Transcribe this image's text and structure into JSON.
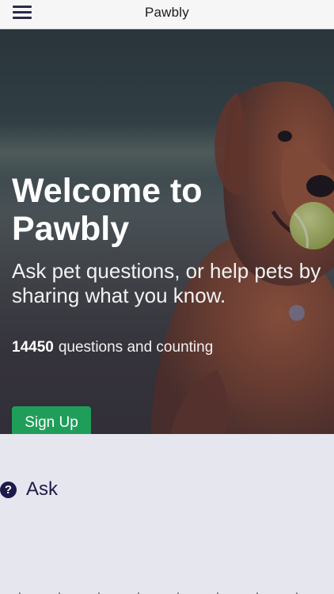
{
  "navbar": {
    "title": "Pawbly",
    "menu_icon": "hamburger-menu-icon"
  },
  "hero": {
    "title": "Welcome to Pawbly",
    "subtitle": "Ask pet questions, or help pets by sharing what you know.",
    "question_count": "14450",
    "question_count_suffix": "questions and counting",
    "signup_label": "Sign Up"
  },
  "ask": {
    "icon": "question-circle-icon",
    "label": "Ask"
  },
  "colors": {
    "brand_dark": "#1e1b4b",
    "signup_green": "#1f9e5a",
    "page_background": "#e6e6ef",
    "navbar_background": "#f6f6f6"
  }
}
